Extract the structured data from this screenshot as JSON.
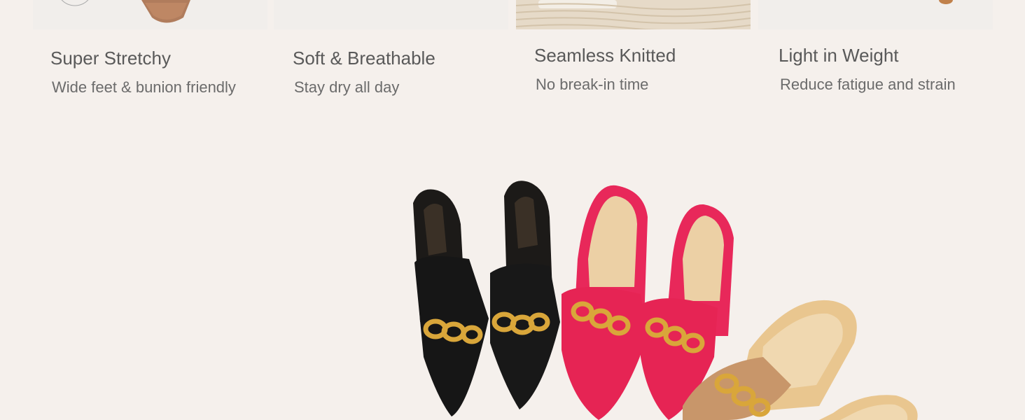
{
  "features": [
    {
      "title": "Super Stretchy",
      "subtitle": "Wide feet & bunion friendly"
    },
    {
      "title": "Soft & Breathable",
      "subtitle": "Stay dry all day"
    },
    {
      "title": "Seamless Knitted",
      "subtitle": "No break-in time"
    },
    {
      "title": "Light in Weight",
      "subtitle": "Reduce fatigue and strain"
    }
  ],
  "colors": {
    "background": "#f5f0ec",
    "text_title": "#595959",
    "text_subtitle": "#6b6b6b",
    "shoe_black": "#1a1a1a",
    "shoe_pink": "#e8285a",
    "shoe_tan": "#c8966a",
    "chain_gold": "#d9a63a"
  },
  "images": {
    "top_tiles": [
      "stretchy-knit-closeup",
      "breathable-fabric-image",
      "seamless-knit-texture",
      "lightweight-shoe-image"
    ],
    "hero": "three-pairs-chain-mules"
  }
}
